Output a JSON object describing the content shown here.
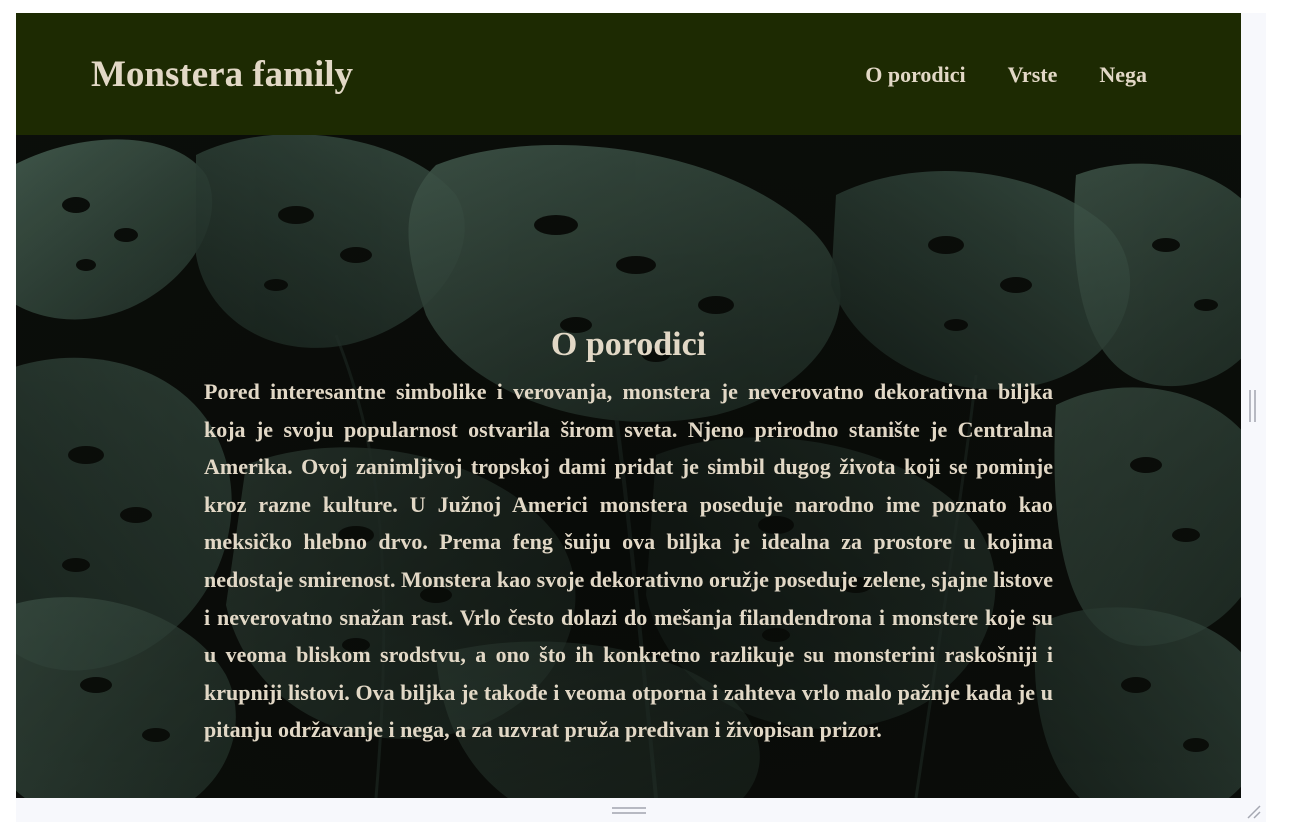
{
  "header": {
    "brand": "Monstera family",
    "nav": [
      {
        "label": "O porodici"
      },
      {
        "label": "Vrste"
      },
      {
        "label": "Nega"
      }
    ]
  },
  "section": {
    "heading": "O porodici",
    "body": "Pored interesantne simbolike i verovanja, monstera je neverovatno dekorativna biljka koja je svoju popularnost ostvarila širom sveta. Njeno prirodno stanište je Centralna Amerika. Ovoj zanimljivoj tropskoj dami pridat je simbil dugog života koji se pominje kroz razne kulture. U Južnoj Americi monstera poseduje narodno ime poznato kao meksičko hlebno drvo. Prema feng šuiju ova biljka je idealna za prostore u kojima nedostaje smirenost. Monstera kao svoje dekorativno oružje poseduje zelene, sjajne listove i neverovatno snažan rast. Vrlo često dolazi do mešanja filandendrona i monstere koje su u veoma bliskom srodstvu, a ono što ih konkretno razlikuje su monsterini raskošniji i krupniji listovi. Ova biljka je takođe i veoma otporna i zahteva vrlo malo pažnje kada je u pitanju održavanje i nega, a za uzvrat pruža predivan i živopisan prizor."
  },
  "colors": {
    "header_bg": "#1d2a02",
    "text": "#e2d8c6",
    "leaf": "#3c5448",
    "background": "#0b0e0a"
  },
  "icons": {
    "vertical_scroll": "scroll-handle-icon",
    "horizontal_scroll": "scroll-handle-icon",
    "resize": "resize-grip-icon"
  }
}
